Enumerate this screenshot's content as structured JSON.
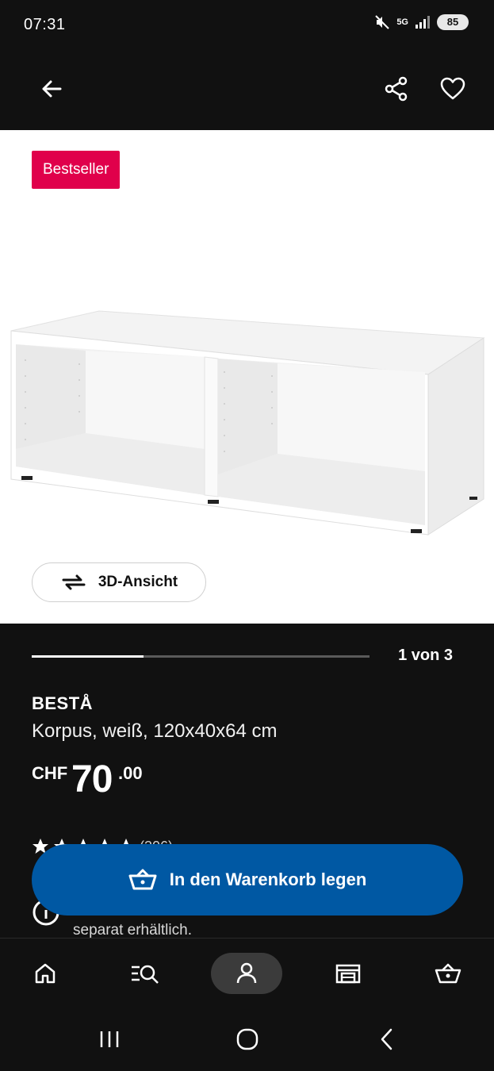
{
  "status_bar": {
    "time": "07:31",
    "network": "5G",
    "battery": "85"
  },
  "header": {
    "back_icon": "arrow-left-icon",
    "share_icon": "share-icon",
    "favorite_icon": "heart-icon"
  },
  "product_image": {
    "badge": "Bestseller",
    "view3d_label": "3D-Ansicht"
  },
  "gallery": {
    "pager": "1 von 3",
    "progress": 0.33
  },
  "product": {
    "name": "BESTÅ",
    "description": "Korpus, weiß, 120x40x64 cm",
    "price_currency": "CHF",
    "price_int": "70",
    "price_decimal": ".00",
    "rating_count": "(306)",
    "info_text": "separat erhältlich."
  },
  "cart": {
    "label": "In den Warenkorb legen"
  },
  "bottom_nav": {
    "items": [
      "home-icon",
      "search-list-icon",
      "profile-icon",
      "store-icon",
      "cart-icon"
    ],
    "active": "profile-icon"
  },
  "colors": {
    "background": "#111111",
    "badge": "#e0004b",
    "cart_button": "#0058a3"
  }
}
